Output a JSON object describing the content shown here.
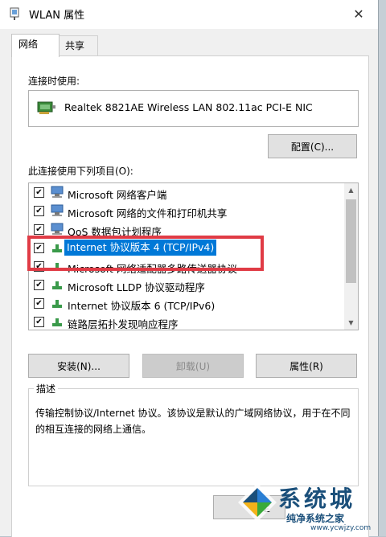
{
  "window": {
    "title": "WLAN 属性"
  },
  "tabs": [
    {
      "label": "网络",
      "active": true
    },
    {
      "label": "共享",
      "active": false
    }
  ],
  "connect_using": {
    "label": "连接时使用:",
    "adapter": "Realtek 8821AE Wireless LAN 802.11ac PCI-E NIC",
    "configure_button": "配置(C)..."
  },
  "items_section": {
    "label": "此连接使用下列项目(O):",
    "items": [
      {
        "label": "Microsoft 网络客户端",
        "checked": true,
        "selected": false,
        "icon": "network-client-icon"
      },
      {
        "label": "Microsoft 网络的文件和打印机共享",
        "checked": true,
        "selected": false,
        "icon": "file-printer-sharing-icon"
      },
      {
        "label": "QoS 数据包计划程序",
        "checked": true,
        "selected": false,
        "icon": "qos-scheduler-icon"
      },
      {
        "label": "Internet 协议版本 4 (TCP/IPv4)",
        "checked": true,
        "selected": true,
        "icon": "protocol-icon"
      },
      {
        "label": "Microsoft 网络适配器多路传送器协议",
        "checked": true,
        "selected": false,
        "icon": "protocol-icon"
      },
      {
        "label": "Microsoft LLDP 协议驱动程序",
        "checked": true,
        "selected": false,
        "icon": "protocol-icon"
      },
      {
        "label": "Internet 协议版本 6 (TCP/IPv6)",
        "checked": true,
        "selected": false,
        "icon": "protocol-icon"
      },
      {
        "label": "链路层拓扑发现响应程序",
        "checked": true,
        "selected": false,
        "icon": "protocol-icon"
      }
    ]
  },
  "buttons": {
    "install": "安装(N)...",
    "uninstall": "卸载(U)",
    "properties": "属性(R)"
  },
  "description": {
    "title": "描述",
    "text": "传输控制协议/Internet 协议。该协议是默认的广域网络协议，用于在不同的相互连接的网络上通信。"
  },
  "footer": {
    "ok_fragment": "定"
  },
  "watermark": {
    "line1": "系统城",
    "line2": "纯净系统之家",
    "line3": "www.ycwjzy.com"
  },
  "colors": {
    "selection": "#0078d7",
    "highlight_box": "#e03b45",
    "watermark": "#1a4f7a"
  }
}
